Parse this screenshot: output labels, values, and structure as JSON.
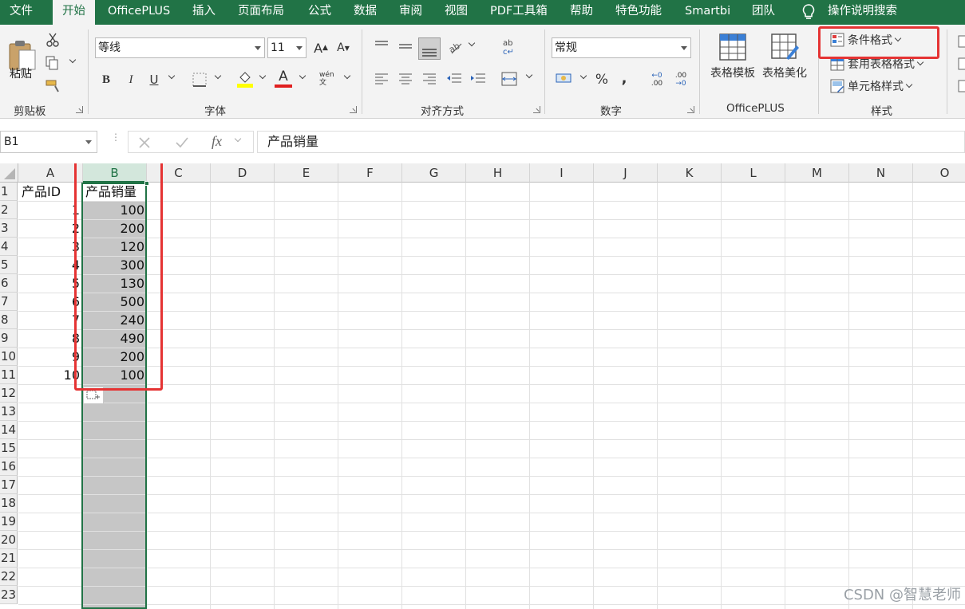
{
  "menu": {
    "tabs": [
      "文件",
      "开始",
      "OfficePLUS",
      "插入",
      "页面布局",
      "公式",
      "数据",
      "审阅",
      "视图",
      "PDF工具箱",
      "帮助",
      "特色功能",
      "Smartbi",
      "团队"
    ],
    "search": "操作说明搜索",
    "active_tab": "开始"
  },
  "ribbon": {
    "clipboard": {
      "paste": "粘贴",
      "group": "剪贴板"
    },
    "font": {
      "name": "等线",
      "size": "11",
      "group": "字体",
      "phonetic": "wén 文"
    },
    "alignment": {
      "group": "对齐方式"
    },
    "number": {
      "format": "常规",
      "group": "数字",
      "percent": "%",
      "comma": ",",
      "increase_decimal": ".00",
      "decrease_decimal": ".00"
    },
    "officeplus": {
      "table_template": "表格模板",
      "table_beautify": "表格美化",
      "group": "OfficePLUS"
    },
    "styles": {
      "conditional_format": "条件格式",
      "format_as_table": "套用表格格式",
      "cell_styles": "单元格样式",
      "group": "样式"
    }
  },
  "formula_bar": {
    "name_box": "B1",
    "fx": "fx",
    "content": "产品销量"
  },
  "grid": {
    "columns": [
      "A",
      "B",
      "C",
      "D",
      "E",
      "F",
      "G",
      "H",
      "I",
      "J",
      "K",
      "L",
      "M",
      "N",
      "O"
    ],
    "rows": [
      "1",
      "2",
      "3",
      "4",
      "5",
      "6",
      "7",
      "8",
      "9",
      "10",
      "11",
      "12",
      "13",
      "14",
      "15",
      "16",
      "17",
      "18",
      "19",
      "20",
      "21",
      "22",
      "23"
    ],
    "selected_column": "B",
    "header": {
      "A": "产品ID",
      "B": "产品销量"
    },
    "data": [
      {
        "id": "1",
        "sales": "100"
      },
      {
        "id": "2",
        "sales": "200"
      },
      {
        "id": "3",
        "sales": "120"
      },
      {
        "id": "4",
        "sales": "300"
      },
      {
        "id": "5",
        "sales": "130"
      },
      {
        "id": "6",
        "sales": "500"
      },
      {
        "id": "7",
        "sales": "240"
      },
      {
        "id": "8",
        "sales": "490"
      },
      {
        "id": "9",
        "sales": "200"
      },
      {
        "id": "10",
        "sales": "100"
      }
    ]
  },
  "watermark": "CSDN @智慧老师",
  "colors": {
    "accent": "#217346",
    "highlight": "#e53333",
    "selection_fill": "#c6c6c6"
  }
}
